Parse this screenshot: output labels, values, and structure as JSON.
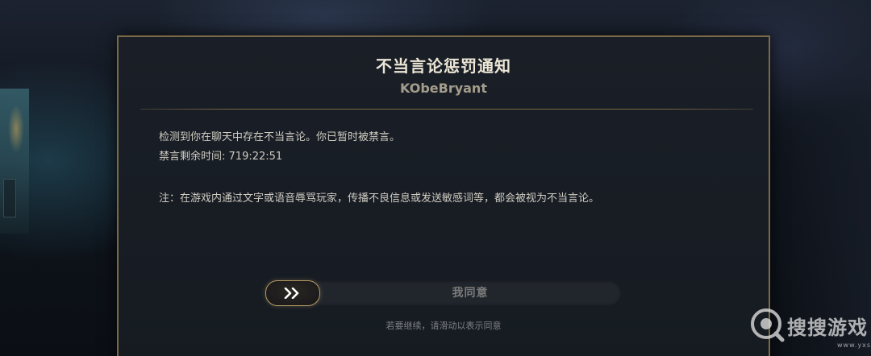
{
  "dialog": {
    "title": "不当言论惩罚通知",
    "username": "KObeBryant",
    "message_line1": "检测到你在聊天中存在不当言论。你已暂时被禁言。",
    "timer_label": "禁言剩余时间:",
    "timer_value": "719:22:51",
    "note": "注：在游戏内通过文字或语音辱骂玩家，传播不良信息或发送敏感词等，都会被视为不当言论。"
  },
  "slider": {
    "knob_icon": "double-chevron-right-icon",
    "label": "我同意",
    "progress": 0
  },
  "hint": "若要继续，请滑动以表示同意",
  "watermark": {
    "logo_icon": "magnifier-logo-icon",
    "text": "搜搜游戏",
    "url": "www.yxss.com"
  },
  "colors": {
    "dialog_border": "#7b6a48",
    "dialog_bg": "#1a1f27",
    "title": "#ece6d6",
    "body_text": "#cfcbc1",
    "accent_gold": "#b59a63"
  }
}
